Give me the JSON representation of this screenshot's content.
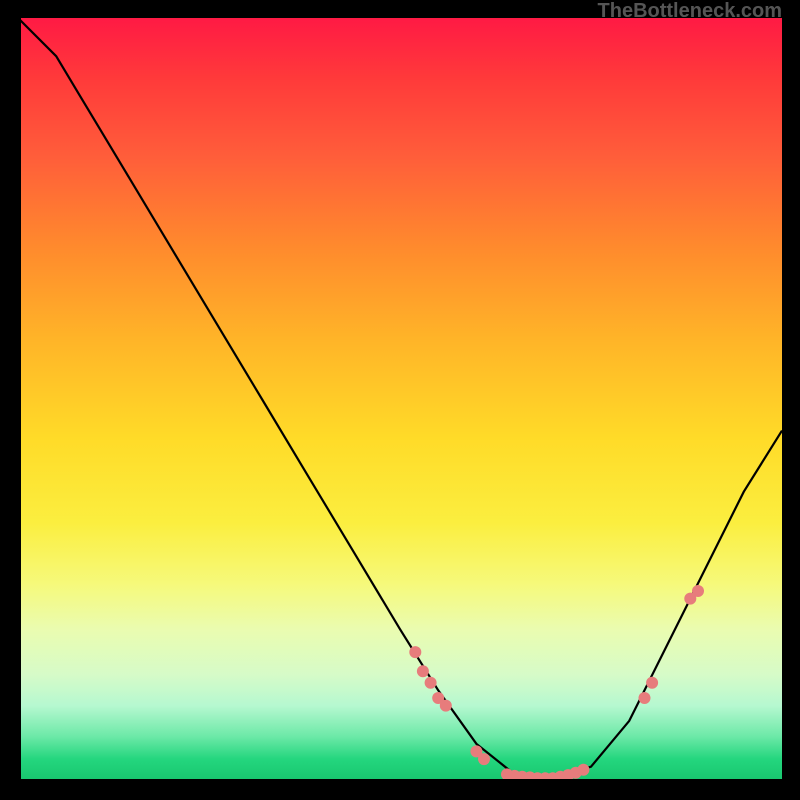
{
  "watermark": "TheBottleneck.com",
  "chart_data": {
    "type": "line",
    "title": "",
    "xlabel": "",
    "ylabel": "",
    "xlim": [
      0,
      100
    ],
    "ylim": [
      0,
      100
    ],
    "description": "Bottleneck curve: V-shaped line showing bottleneck percentage vs some metric. Minimum (optimal zone, green) near x≈62-72 at y≈0. Left arm rises steeply to ~100 at x=0; right arm rises more gently to ~45 at x=100.",
    "curve_points": [
      {
        "x": 0,
        "y": 100
      },
      {
        "x": 5,
        "y": 95
      },
      {
        "x": 8,
        "y": 90
      },
      {
        "x": 14,
        "y": 80
      },
      {
        "x": 20,
        "y": 70
      },
      {
        "x": 26,
        "y": 60
      },
      {
        "x": 32,
        "y": 50
      },
      {
        "x": 38,
        "y": 40
      },
      {
        "x": 44,
        "y": 30
      },
      {
        "x": 50,
        "y": 20
      },
      {
        "x": 55,
        "y": 12
      },
      {
        "x": 60,
        "y": 5
      },
      {
        "x": 65,
        "y": 1
      },
      {
        "x": 70,
        "y": 0.5
      },
      {
        "x": 75,
        "y": 2
      },
      {
        "x": 80,
        "y": 8
      },
      {
        "x": 85,
        "y": 18
      },
      {
        "x": 90,
        "y": 28
      },
      {
        "x": 95,
        "y": 38
      },
      {
        "x": 100,
        "y": 46
      }
    ],
    "highlighted_points": [
      {
        "x": 52,
        "y": 17
      },
      {
        "x": 53,
        "y": 14.5
      },
      {
        "x": 54,
        "y": 13
      },
      {
        "x": 55,
        "y": 11
      },
      {
        "x": 56,
        "y": 10
      },
      {
        "x": 60,
        "y": 4
      },
      {
        "x": 61,
        "y": 3
      },
      {
        "x": 64,
        "y": 1
      },
      {
        "x": 65,
        "y": 0.8
      },
      {
        "x": 66,
        "y": 0.7
      },
      {
        "x": 67,
        "y": 0.6
      },
      {
        "x": 68,
        "y": 0.5
      },
      {
        "x": 69,
        "y": 0.5
      },
      {
        "x": 70,
        "y": 0.5
      },
      {
        "x": 71,
        "y": 0.7
      },
      {
        "x": 72,
        "y": 0.9
      },
      {
        "x": 73,
        "y": 1.2
      },
      {
        "x": 74,
        "y": 1.6
      },
      {
        "x": 82,
        "y": 11
      },
      {
        "x": 83,
        "y": 13
      },
      {
        "x": 88,
        "y": 24
      },
      {
        "x": 89,
        "y": 25
      }
    ],
    "grid": false,
    "legend": false
  }
}
